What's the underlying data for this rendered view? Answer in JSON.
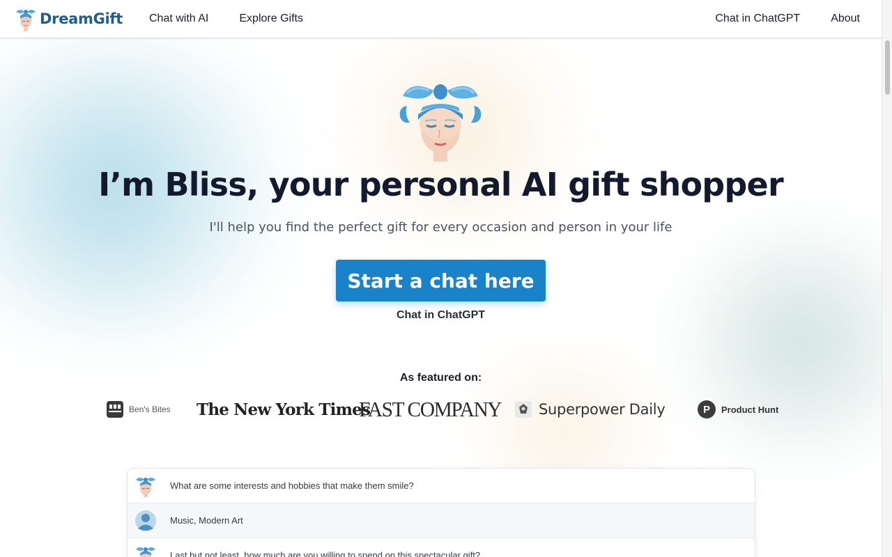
{
  "nav": {
    "brand": "DreamGift",
    "left_links": [
      "Chat with AI",
      "Explore Gifts"
    ],
    "right_links": [
      "Chat in ChatGPT",
      "About"
    ]
  },
  "hero": {
    "headline": "I’m Bliss, your personal AI gift shopper",
    "subhead": "I'll help you find the perfect gift for every occasion and person in your life",
    "cta_label": "Start a chat here",
    "secondary_link": "Chat in ChatGPT"
  },
  "featured": {
    "label": "As featured on:",
    "logos": [
      "Ben's Bites",
      "The New York Times",
      "FAST COMPANY",
      "Superpower Daily",
      "Product Hunt"
    ],
    "product_hunt_letter": "P"
  },
  "chat_preview": [
    {
      "sender": "bot",
      "text": "What are some interests and hobbies that make them smile?"
    },
    {
      "sender": "user",
      "text": "Music, Modern Art"
    },
    {
      "sender": "bot",
      "text": "Last but not least, how much are you willing to spend on this spectacular gift?"
    }
  ],
  "colors": {
    "brand_blue": "#1f5e8a",
    "cta_blue": "#1a82c8",
    "headline": "#141a2e"
  }
}
